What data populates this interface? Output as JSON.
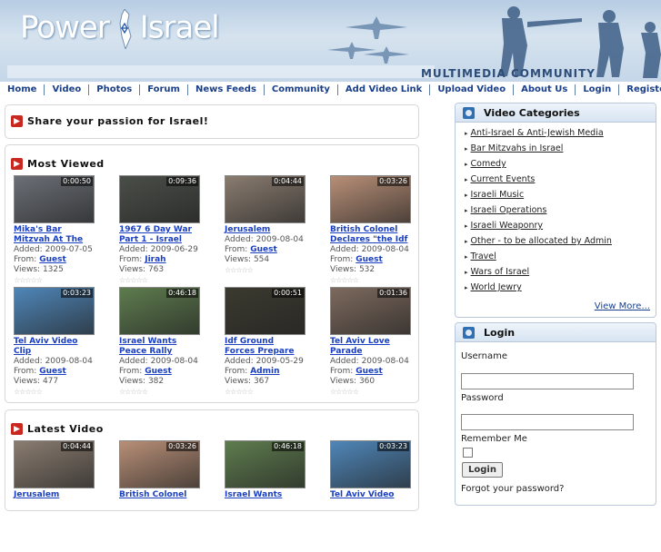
{
  "site": {
    "name_left": "Power",
    "name_right": "Israel",
    "tagline": "MULTIMEDIA COMMUNITY"
  },
  "nav": [
    "Home",
    "Video",
    "Photos",
    "Forum",
    "News Feeds",
    "Community",
    "Add Video Link",
    "Upload Video",
    "About Us",
    "Login",
    "Register"
  ],
  "share": {
    "text": "Share your passion for Israel!"
  },
  "most_viewed": {
    "heading": "Most Viewed",
    "items": [
      {
        "dur": "0:00:50",
        "title1": "Mika's Bar",
        "title2": "Mitzvah At The",
        "added": "Added: 2009-07-05",
        "from_label": "From:",
        "user": "Guest",
        "views": "Views: 1325",
        "color": "#6b6f76"
      },
      {
        "dur": "0:09:36",
        "title1": "1967 6 Day War",
        "title2": "Part 1 - Israel",
        "added": "Added: 2009-06-29",
        "from_label": "From:",
        "user": "Jirah",
        "views": "Views: 763",
        "color": "#4a4e48"
      },
      {
        "dur": "0:04:44",
        "title1": "Jerusalem",
        "title2": "",
        "added": "Added: 2009-08-04",
        "from_label": "From:",
        "user": "Guest",
        "views": "Views: 554",
        "color": "#8a7c70"
      },
      {
        "dur": "0:03:26",
        "title1": "British Colonel",
        "title2": "Declares \"the Idf",
        "added": "Added: 2009-08-04",
        "from_label": "From:",
        "user": "Guest",
        "views": "Views: 532",
        "color": "#b88f77"
      },
      {
        "dur": "0:03:23",
        "title1": "Tel Aviv Video",
        "title2": "Clip",
        "added": "Added: 2009-08-04",
        "from_label": "From:",
        "user": "Guest",
        "views": "Views: 477",
        "color": "#4f86b8"
      },
      {
        "dur": "0:46:18",
        "title1": "Israel Wants",
        "title2": "Peace Rally",
        "added": "Added: 2009-08-04",
        "from_label": "From:",
        "user": "Guest",
        "views": "Views: 382",
        "color": "#5e7c4e"
      },
      {
        "dur": "0:00:51",
        "title1": "Idf Ground",
        "title2": "Forces Prepare",
        "added": "Added: 2009-05-29",
        "from_label": "From:",
        "user": "Admin",
        "views": "Views: 367",
        "color": "#3b3a2f"
      },
      {
        "dur": "0:01:36",
        "title1": "Tel Aviv Love",
        "title2": "Parade",
        "added": "Added: 2009-08-04",
        "from_label": "From:",
        "user": "Guest",
        "views": "Views: 360",
        "color": "#7d6a5e"
      }
    ]
  },
  "latest": {
    "heading": "Latest Video",
    "items": [
      {
        "dur": "0:04:44",
        "title1": "Jerusalem",
        "color": "#8a7c70"
      },
      {
        "dur": "0:03:26",
        "title1": "British Colonel",
        "color": "#b88f77"
      },
      {
        "dur": "0:46:18",
        "title1": "Israel Wants",
        "color": "#5e7c4e"
      },
      {
        "dur": "0:03:23",
        "title1": "Tel Aviv Video",
        "color": "#4f86b8"
      }
    ]
  },
  "categories": {
    "heading": "Video Categories",
    "items": [
      "Anti-Israel & Anti-Jewish Media",
      "Bar Mitzvahs in Israel",
      "Comedy",
      "Current Events",
      "Israeli Music",
      "Israeli Operations",
      "Israeli Weaponry",
      "Other - to be allocated by Admin",
      "Travel",
      "Wars of Israel",
      "World Jewry"
    ],
    "view_more": "View More..."
  },
  "login": {
    "heading": "Login",
    "username_label": "Username",
    "password_label": "Password",
    "remember_label": "Remember Me",
    "button": "Login",
    "forgot": "Forgot your password?"
  },
  "colors": {
    "link": "#1a3fbf",
    "nav": "#1a3f8a",
    "flag": "#c8281f",
    "side_icon": "#2f6fb4"
  }
}
